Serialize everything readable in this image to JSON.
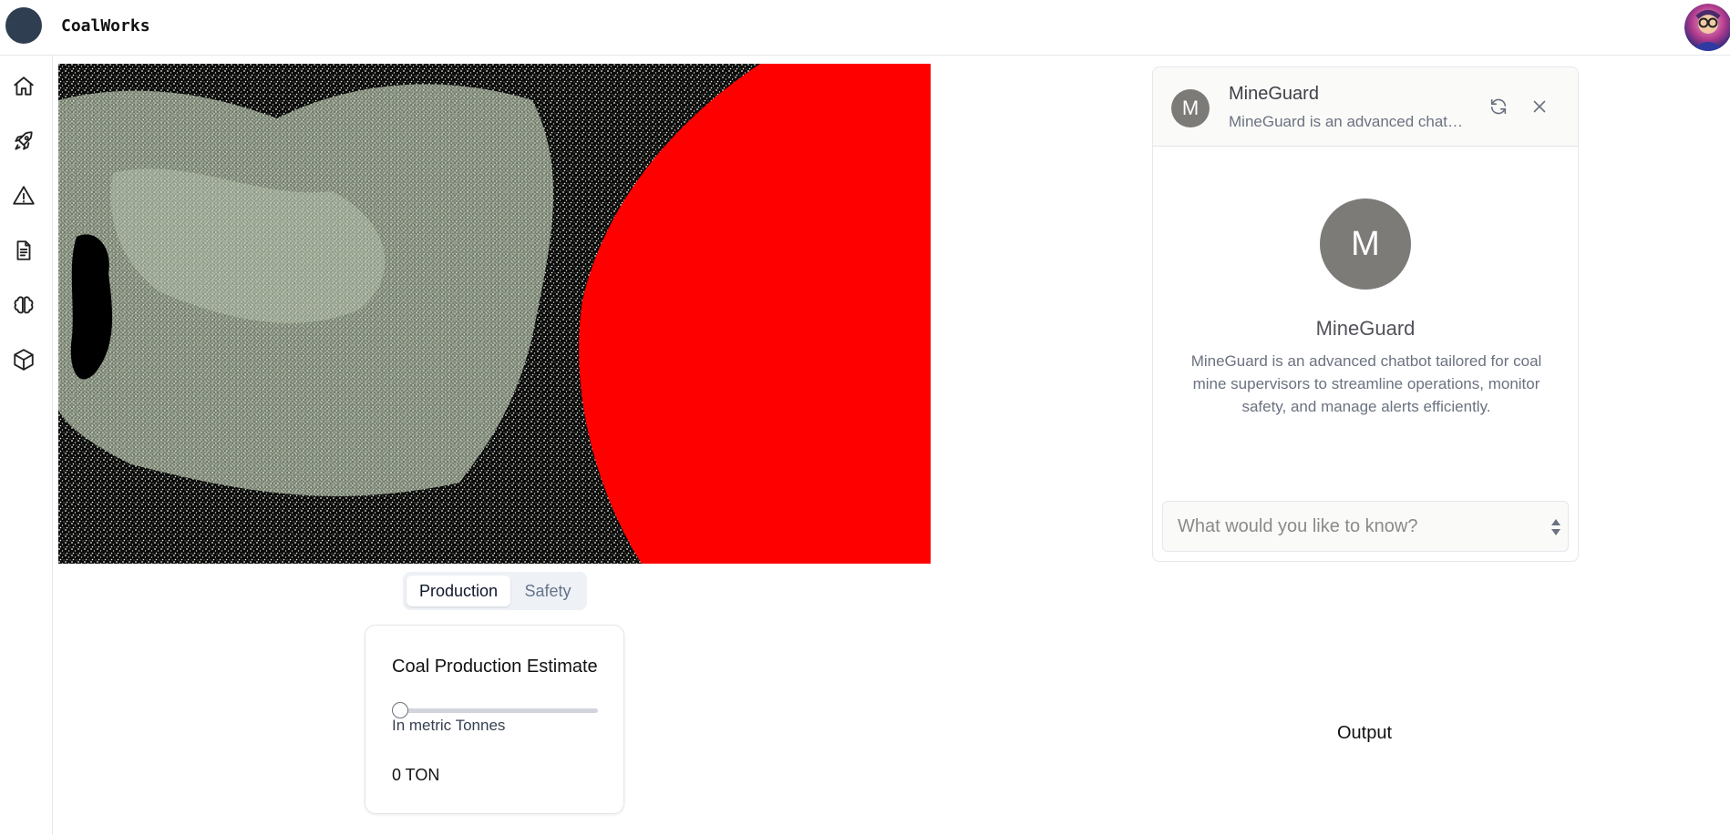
{
  "app": {
    "brand_name": "CoalWorks"
  },
  "sidebar": {
    "items": [
      {
        "name": "home-icon"
      },
      {
        "name": "rocket-icon"
      },
      {
        "name": "warning-icon"
      },
      {
        "name": "document-icon"
      },
      {
        "name": "brain-icon"
      },
      {
        "name": "cube-icon"
      }
    ]
  },
  "tabs": {
    "production_label": "Production",
    "safety_label": "Safety",
    "active": "Production"
  },
  "estimate_card": {
    "title": "Coal Production Estimate",
    "slider_value": 0,
    "unit_label": "In metric Tonnes",
    "value_text": "0 TON"
  },
  "chat": {
    "header_avatar_letter": "M",
    "header_name": "MineGuard",
    "header_desc": "MineGuard is an advanced chatbot tailored for coal mine supervisors to streamline operations, monitor safety, and manage alerts efficiently.",
    "big_avatar_letter": "M",
    "title": "MineGuard",
    "description": "MineGuard is an advanced chatbot tailored for coal mine supervisors to streamline operations, monitor safety, and manage alerts efficiently.",
    "input_placeholder": "What would you like to know?",
    "input_value": ""
  },
  "output": {
    "label": "Output"
  },
  "colors": {
    "hero_red": "#ff0000",
    "brand_dot": "#2f3e50",
    "avatar_gray": "#7c7b78"
  }
}
